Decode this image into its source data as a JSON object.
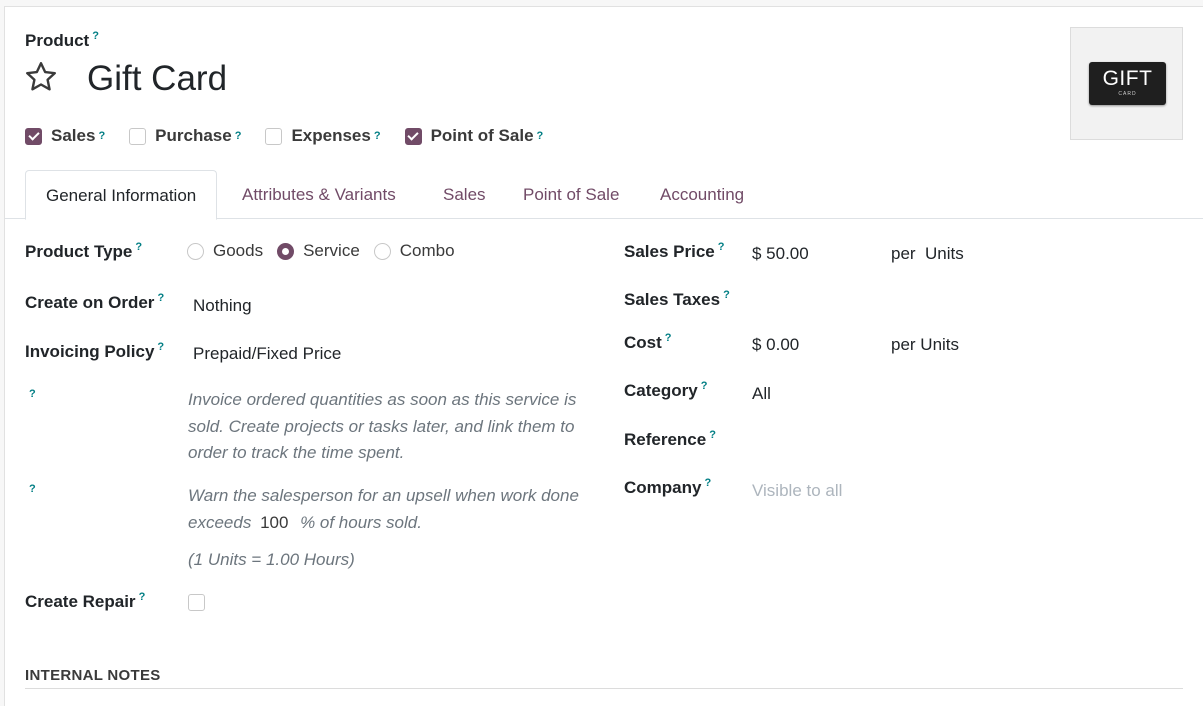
{
  "header": {
    "product_label": "Product",
    "help_mark": "?",
    "title": "Gift Card",
    "image": {
      "line1": "GIFT",
      "line2": "CARD"
    }
  },
  "checkboxes": [
    {
      "label": "Sales",
      "checked": true
    },
    {
      "label": "Purchase",
      "checked": false
    },
    {
      "label": "Expenses",
      "checked": false
    },
    {
      "label": "Point of Sale",
      "checked": true
    }
  ],
  "tabs": [
    {
      "label": "General Information",
      "active": true
    },
    {
      "label": "Attributes & Variants",
      "active": false
    },
    {
      "label": "Sales",
      "active": false
    },
    {
      "label": "Point of Sale",
      "active": false
    },
    {
      "label": "Accounting",
      "active": false
    }
  ],
  "left": {
    "product_type": {
      "label": "Product Type",
      "options": [
        "Goods",
        "Service",
        "Combo"
      ],
      "selected": "Service"
    },
    "create_on_order": {
      "label": "Create on Order",
      "value": "Nothing"
    },
    "invoicing_policy": {
      "label": "Invoicing Policy",
      "value": "Prepaid/Fixed Price"
    },
    "invoice_note": {
      "line1": "Invoice ordered quantities as soon as this service is",
      "line2": "sold. Create projects or tasks later, and link them to",
      "line3": "order to track the time spent."
    },
    "upsell_note": {
      "line1": "Warn the salesperson for an upsell when work done",
      "prefix": "exceeds",
      "value": "100",
      "suffix": "% of hours sold."
    },
    "conversion": "(1 Units = 1.00 Hours)",
    "create_repair": {
      "label": "Create Repair",
      "checked": false
    }
  },
  "right": {
    "sales_price": {
      "label": "Sales Price",
      "value": "$ 50.00",
      "unit": "per  Units"
    },
    "sales_taxes": {
      "label": "Sales Taxes",
      "value": ""
    },
    "cost": {
      "label": "Cost",
      "value": "$ 0.00",
      "unit": "per Units"
    },
    "category": {
      "label": "Category",
      "value": "All"
    },
    "reference": {
      "label": "Reference",
      "value": ""
    },
    "company": {
      "label": "Company",
      "placeholder": "Visible to all"
    }
  },
  "internal_notes": {
    "label": "INTERNAL NOTES"
  },
  "colors": {
    "accent": "#714b67",
    "help": "#017e84"
  }
}
